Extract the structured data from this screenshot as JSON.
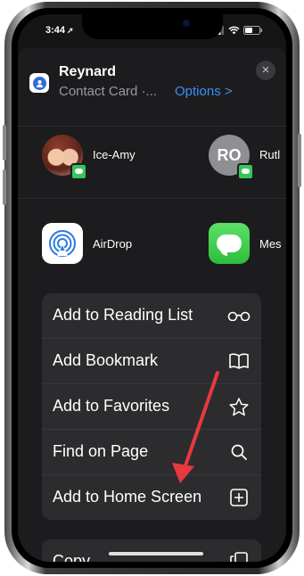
{
  "status_bar": {
    "time": "3:44",
    "location_glyph": "➚"
  },
  "sheet": {
    "title": "Reynard",
    "subtitle": "Contact Card ·...",
    "options_label": "Options >",
    "close_glyph": "×"
  },
  "people": [
    {
      "name": "Ice-Amy",
      "avatar": "photo"
    },
    {
      "name": "Rutl",
      "avatar_initials": "RO"
    }
  ],
  "apps": [
    {
      "name": "AirDrop",
      "icon": "airdrop-icon"
    },
    {
      "name": "Mes",
      "icon": "messages-icon"
    }
  ],
  "actions": [
    {
      "label": "Add to Reading List",
      "icon": "reading-list-glasses-icon"
    },
    {
      "label": "Add Bookmark",
      "icon": "bookmark-book-icon"
    },
    {
      "label": "Add to Favorites",
      "icon": "star-icon"
    },
    {
      "label": "Find on Page",
      "icon": "search-icon"
    },
    {
      "label": "Add to Home Screen",
      "icon": "add-square-icon"
    }
  ],
  "actions2": [
    {
      "label": "Copy",
      "icon": "copy-icon"
    }
  ],
  "colors": {
    "accent": "#3d8ef7",
    "sheet_bg": "#1c1c1e",
    "group_bg": "#2c2c2e",
    "annotation_arrow": "#e8393f"
  }
}
